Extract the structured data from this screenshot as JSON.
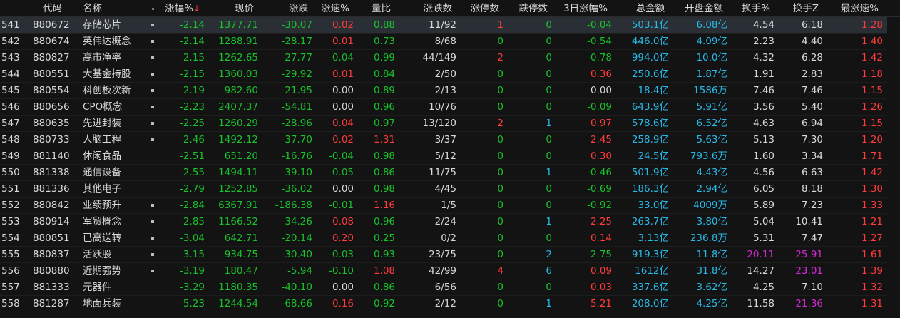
{
  "colors": {
    "up": "#ff3b3b",
    "down": "#19c22b",
    "neutral": "#d8d8d8",
    "amount": "#28b9e6",
    "name_highlight": "#e8d12b",
    "turnover_high": "#d22bd2",
    "background": "#131313",
    "selected_row": "#2a2f36"
  },
  "header": {
    "code": "代码",
    "name": "名称",
    "mark": "•",
    "pct": "涨幅%",
    "sort_indicator": "↓",
    "price": "现价",
    "change": "涨跌",
    "speed": "涨速%",
    "vol_ratio": "量比",
    "up_down_count": "涨跌数",
    "limit_up": "涨停数",
    "limit_down": "跌停数",
    "pct_3d": "3日涨幅%",
    "amount": "总金额",
    "open_amount": "开盘金额",
    "turnover": "换手%",
    "turnover_z": "换手Z",
    "max_speed": "最涨速%"
  },
  "rows": [
    {
      "idx": "541",
      "code": "880672",
      "name": "存储芯片",
      "mark": true,
      "pct": "-2.14",
      "price": "1377.71",
      "chg": "-30.07",
      "speed": "0.02",
      "ratio": "0.88",
      "updn": "11/92",
      "lu": "1",
      "ld": "0",
      "d3": "-0.04",
      "amt": "503.1亿",
      "open": "6.08亿",
      "turn": "4.54",
      "turnz": "6.18",
      "max": "1.28",
      "selected": true
    },
    {
      "idx": "542",
      "code": "880674",
      "name": "英伟达概念",
      "mark": true,
      "pct": "-2.14",
      "price": "1288.91",
      "chg": "-28.17",
      "speed": "0.01",
      "ratio": "0.73",
      "updn": "8/68",
      "lu": "0",
      "ld": "0",
      "d3": "-0.54",
      "amt": "446.0亿",
      "open": "4.09亿",
      "turn": "2.23",
      "turnz": "4.40",
      "max": "1.40"
    },
    {
      "idx": "543",
      "code": "880827",
      "name": "高市净率",
      "mark": true,
      "pct": "-2.15",
      "price": "1262.65",
      "chg": "-27.77",
      "speed": "-0.04",
      "ratio": "0.99",
      "updn": "44/149",
      "lu": "2",
      "ld": "0",
      "d3": "-0.78",
      "amt": "994.0亿",
      "open": "10.0亿",
      "turn": "4.32",
      "turnz": "6.28",
      "max": "1.42"
    },
    {
      "idx": "544",
      "code": "880551",
      "name": "大基金持股",
      "mark": true,
      "pct": "-2.15",
      "price": "1360.03",
      "chg": "-29.92",
      "speed": "0.01",
      "ratio": "0.84",
      "updn": "2/50",
      "lu": "0",
      "ld": "0",
      "d3": "0.36",
      "amt": "250.6亿",
      "open": "1.87亿",
      "turn": "1.91",
      "turnz": "2.83",
      "max": "1.18"
    },
    {
      "idx": "545",
      "code": "880554",
      "name": "科创板次新",
      "mark": true,
      "pct": "-2.19",
      "price": "982.60",
      "chg": "-21.95",
      "speed": "0.00",
      "ratio": "0.89",
      "updn": "2/13",
      "lu": "0",
      "ld": "0",
      "d3": "0.00",
      "amt": "18.4亿",
      "open": "1586万",
      "turn": "7.46",
      "turnz": "7.46",
      "max": "1.15"
    },
    {
      "idx": "546",
      "code": "880656",
      "name": "CPO概念",
      "mark": true,
      "pct": "-2.23",
      "price": "2407.37",
      "chg": "-54.81",
      "speed": "0.00",
      "ratio": "0.96",
      "updn": "10/76",
      "lu": "0",
      "ld": "0",
      "d3": "-0.09",
      "amt": "643.9亿",
      "open": "5.91亿",
      "turn": "3.56",
      "turnz": "5.40",
      "max": "1.26"
    },
    {
      "idx": "547",
      "code": "880635",
      "name": "先进封装",
      "mark": true,
      "pct": "-2.25",
      "price": "1260.29",
      "chg": "-28.96",
      "speed": "0.04",
      "ratio": "0.97",
      "updn": "13/120",
      "lu": "2",
      "ld": "1",
      "d3": "0.97",
      "amt": "578.6亿",
      "open": "6.52亿",
      "turn": "4.63",
      "turnz": "6.94",
      "max": "1.15"
    },
    {
      "idx": "548",
      "code": "880733",
      "name": "人脑工程",
      "mark": true,
      "pct": "-2.46",
      "price": "1492.12",
      "chg": "-37.70",
      "speed": "0.02",
      "ratio": "1.31",
      "updn": "3/37",
      "lu": "0",
      "ld": "0",
      "d3": "2.45",
      "amt": "258.9亿",
      "open": "5.63亿",
      "turn": "5.13",
      "turnz": "7.30",
      "max": "1.20"
    },
    {
      "idx": "549",
      "code": "881140",
      "name": "休闲食品",
      "mark": false,
      "pct": "-2.51",
      "price": "651.20",
      "chg": "-16.76",
      "speed": "-0.04",
      "ratio": "0.98",
      "updn": "5/12",
      "lu": "0",
      "ld": "0",
      "d3": "0.30",
      "amt": "24.5亿",
      "open": "793.6万",
      "turn": "1.60",
      "turnz": "3.34",
      "max": "1.71"
    },
    {
      "idx": "550",
      "code": "881338",
      "name": "通信设备",
      "mark": false,
      "pct": "-2.55",
      "price": "1494.11",
      "chg": "-39.10",
      "speed": "-0.05",
      "ratio": "0.86",
      "updn": "11/75",
      "lu": "0",
      "ld": "1",
      "d3": "-0.46",
      "amt": "501.9亿",
      "open": "4.43亿",
      "turn": "4.56",
      "turnz": "6.63",
      "max": "1.42"
    },
    {
      "idx": "551",
      "code": "881336",
      "name": "其他电子",
      "mark": false,
      "pct": "-2.79",
      "price": "1252.85",
      "chg": "-36.02",
      "speed": "0.00",
      "ratio": "0.98",
      "updn": "4/45",
      "lu": "0",
      "ld": "0",
      "d3": "-0.69",
      "amt": "186.3亿",
      "open": "2.94亿",
      "turn": "6.05",
      "turnz": "8.18",
      "max": "1.30"
    },
    {
      "idx": "552",
      "code": "880842",
      "name": "业绩预升",
      "mark": true,
      "pct": "-2.84",
      "price": "6367.91",
      "chg": "-186.38",
      "speed": "-0.01",
      "ratio": "1.16",
      "updn": "1/5",
      "lu": "0",
      "ld": "0",
      "d3": "-0.92",
      "amt": "33.0亿",
      "open": "4009万",
      "turn": "5.89",
      "turnz": "7.23",
      "max": "1.33"
    },
    {
      "idx": "553",
      "code": "880914",
      "name": "军贸概念",
      "mark": true,
      "pct": "-2.85",
      "price": "1166.52",
      "chg": "-34.26",
      "speed": "0.08",
      "ratio": "0.96",
      "updn": "2/24",
      "lu": "0",
      "ld": "1",
      "d3": "2.25",
      "amt": "263.7亿",
      "open": "3.80亿",
      "turn": "5.04",
      "turnz": "10.41",
      "max": "1.21"
    },
    {
      "idx": "554",
      "code": "880851",
      "name": "已高送转",
      "mark": true,
      "pct": "-3.04",
      "price": "642.71",
      "chg": "-20.14",
      "speed": "0.20",
      "ratio": "0.25",
      "updn": "0/2",
      "lu": "0",
      "ld": "0",
      "d3": "0.14",
      "amt": "3.13亿",
      "open": "236.8万",
      "turn": "5.31",
      "turnz": "7.47",
      "max": "1.27"
    },
    {
      "idx": "555",
      "code": "880837",
      "name": "活跃股",
      "mark": true,
      "pct": "-3.15",
      "price": "934.75",
      "chg": "-30.40",
      "speed": "-0.03",
      "ratio": "0.93",
      "updn": "23/75",
      "lu": "0",
      "ld": "2",
      "d3": "-2.75",
      "amt": "919.3亿",
      "open": "11.8亿",
      "turn": "20.11",
      "turnz": "25.91",
      "max": "1.61",
      "turn_hi": true,
      "turnz_hi": true
    },
    {
      "idx": "556",
      "code": "880880",
      "name": "近期强势",
      "mark": true,
      "pct": "-3.19",
      "price": "180.47",
      "chg": "-5.94",
      "speed": "-0.10",
      "ratio": "1.08",
      "updn": "42/99",
      "lu": "4",
      "ld": "6",
      "d3": "0.09",
      "amt": "1612亿",
      "open": "31.8亿",
      "turn": "14.27",
      "turnz": "23.01",
      "max": "1.39",
      "turnz_hi": true
    },
    {
      "idx": "557",
      "code": "881333",
      "name": "元器件",
      "mark": false,
      "pct": "-3.29",
      "price": "1180.35",
      "chg": "-40.10",
      "speed": "0.00",
      "ratio": "0.86",
      "updn": "6/56",
      "lu": "0",
      "ld": "0",
      "d3": "0.03",
      "amt": "337.6亿",
      "open": "3.62亿",
      "turn": "4.25",
      "turnz": "7.10",
      "max": "1.32"
    },
    {
      "idx": "558",
      "code": "881287",
      "name": "地面兵装",
      "mark": false,
      "pct": "-5.23",
      "price": "1244.54",
      "chg": "-68.66",
      "speed": "0.16",
      "ratio": "0.92",
      "updn": "2/12",
      "lu": "0",
      "ld": "1",
      "d3": "5.21",
      "amt": "208.0亿",
      "open": "4.25亿",
      "turn": "11.58",
      "turnz": "21.36",
      "max": "1.31",
      "turnz_hi": true
    }
  ]
}
